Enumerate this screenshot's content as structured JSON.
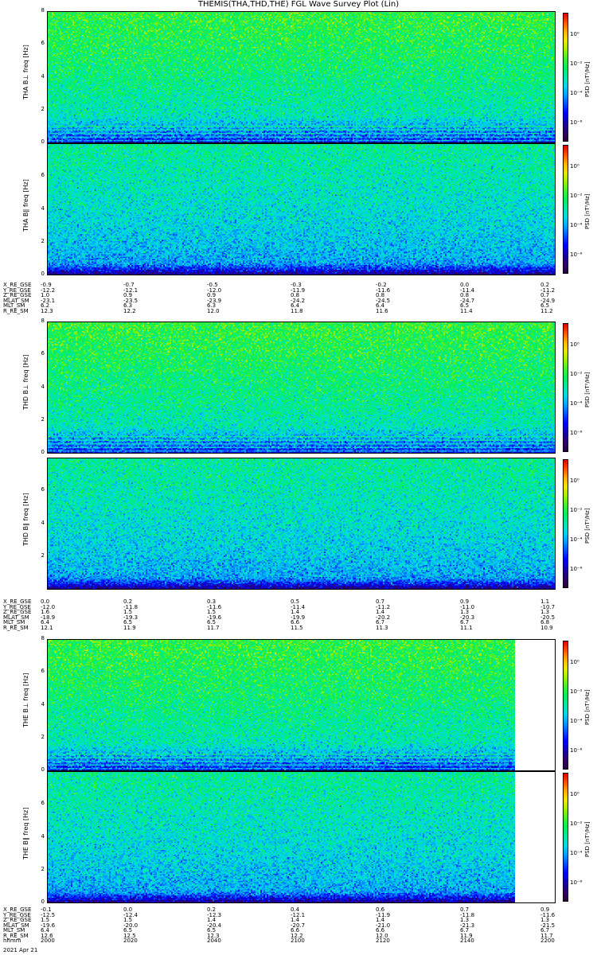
{
  "title": "THEMIS(THA,THD,THE) FGL Wave Survey Plot (Lin)",
  "colors": {
    "colormap": [
      "#2b0040",
      "#30006a",
      "#1400b0",
      "#0000ff",
      "#0050ff",
      "#00a0ff",
      "#00d8e8",
      "#00e8a8",
      "#00ee60",
      "#40f030",
      "#a0f000",
      "#f0e800",
      "#ffb000",
      "#ff5000",
      "#e00000"
    ],
    "background": "#ffffff"
  },
  "chart_data": [
    {
      "type": "heatmap",
      "id": "tha_bl",
      "ylabel": "THA B⊥ freq [Hz]",
      "yticks": [
        "0",
        "2",
        "4",
        "6",
        "8"
      ],
      "ylim": [
        0,
        8
      ],
      "colorbar": {
        "label": "PSD [nT²/Hz]",
        "ticks": [
          "10⁰",
          "10⁻²",
          "10⁻⁴",
          "10⁻⁶"
        ]
      },
      "time_coverage": [
        0,
        1
      ],
      "low_freq_bands": true
    },
    {
      "type": "heatmap",
      "id": "tha_bpar",
      "ylabel": "THA B∥ freq [Hz]",
      "yticks": [
        "0",
        "2",
        "4",
        "6"
      ],
      "ylim": [
        0,
        8
      ],
      "colorbar": {
        "label": "PSD [nT²/Hz]",
        "ticks": [
          "10⁰",
          "10⁻²",
          "10⁻⁴",
          "10⁻⁶"
        ]
      },
      "time_coverage": [
        0,
        1
      ],
      "low_freq_bands": false
    },
    {
      "type": "heatmap",
      "id": "thd_bl",
      "ylabel": "THD B⊥ freq [Hz]",
      "yticks": [
        "0",
        "2",
        "4",
        "6",
        "8"
      ],
      "ylim": [
        0,
        8
      ],
      "colorbar": {
        "label": "PSD [nT²/Hz]",
        "ticks": [
          "10⁰",
          "10⁻²",
          "10⁻⁴",
          "10⁻⁶"
        ]
      },
      "time_coverage": [
        0,
        1
      ],
      "low_freq_bands": true
    },
    {
      "type": "heatmap",
      "id": "thd_bpar",
      "ylabel": "THD B∥ freq [Hz]",
      "yticks": [
        "2",
        "4",
        "6"
      ],
      "ylim": [
        0,
        8
      ],
      "colorbar": {
        "label": "PSD [nT²/Hz]",
        "ticks": [
          "10⁰",
          "10⁻²",
          "10⁻⁴",
          "10⁻⁶"
        ]
      },
      "time_coverage": [
        0,
        1
      ],
      "low_freq_bands": false
    },
    {
      "type": "heatmap",
      "id": "the_bl",
      "ylabel": "THE B⊥ freq [Hz]",
      "yticks": [
        "0",
        "2",
        "4",
        "6",
        "8"
      ],
      "ylim": [
        0,
        8
      ],
      "colorbar": {
        "label": "PSD [nT²/Hz]",
        "ticks": [
          "10⁰",
          "10⁻²",
          "10⁻⁴",
          "10⁻⁶"
        ]
      },
      "time_coverage": [
        0,
        0.92
      ],
      "low_freq_bands": true
    },
    {
      "type": "heatmap",
      "id": "the_bpar",
      "ylabel": "THE B∥ freq [Hz]",
      "yticks": [
        "0",
        "2",
        "4",
        "6"
      ],
      "ylim": [
        0,
        8
      ],
      "colorbar": {
        "label": "PSD [nT²/Hz]",
        "ticks": [
          "10⁰",
          "10⁻²",
          "10⁻⁴",
          "10⁻⁶"
        ]
      },
      "time_coverage": [
        0,
        0.92
      ],
      "low_freq_bands": false
    }
  ],
  "ephemeris_blocks": [
    {
      "id": "tha",
      "rows": [
        {
          "name": "X_RE_GSE",
          "values": [
            "-0.9",
            "-0.7",
            "-0.5",
            "-0.3",
            "-0.2",
            "0.0",
            "0.2"
          ]
        },
        {
          "name": "Y_RE_GSE",
          "values": [
            "-12.2",
            "-12.1",
            "-12.0",
            "-11.9",
            "-11.6",
            "-11.4",
            "-11.2"
          ]
        },
        {
          "name": "Z_RE_GSE",
          "values": [
            "1.0",
            "0.9",
            "0.9",
            "0.8",
            "0.8",
            "0.8",
            "0.7"
          ]
        },
        {
          "name": "MLAT_SM",
          "values": [
            "-23.1",
            "-23.5",
            "-23.9",
            "-24.2",
            "-24.5",
            "-24.7",
            "-24.9"
          ]
        },
        {
          "name": "MLT_SM",
          "values": [
            "6.2",
            "6.3",
            "6.3",
            "6.4",
            "6.4",
            "6.5",
            "6.5"
          ]
        },
        {
          "name": "R_RE_SM",
          "values": [
            "12.3",
            "12.2",
            "12.0",
            "11.8",
            "11.6",
            "11.4",
            "11.2"
          ]
        }
      ]
    },
    {
      "id": "thd",
      "rows": [
        {
          "name": "X_RE_GSE",
          "values": [
            "0.0",
            "0.2",
            "0.3",
            "0.5",
            "0.7",
            "0.9",
            "1.1"
          ]
        },
        {
          "name": "Y_RE_GSE",
          "values": [
            "-12.0",
            "-11.8",
            "-11.6",
            "-11.4",
            "-11.2",
            "-11.0",
            "-10.7"
          ]
        },
        {
          "name": "Z_RE_GSE",
          "values": [
            "1.6",
            "1.5",
            "1.5",
            "1.4",
            "1.4",
            "1.3",
            "1.3"
          ]
        },
        {
          "name": "MLAT_SM",
          "values": [
            "-18.9",
            "-19.3",
            "-19.6",
            "-19.9",
            "-20.2",
            "-20.3",
            "-20.5"
          ]
        },
        {
          "name": "MLT_SM",
          "values": [
            "6.4",
            "6.5",
            "6.5",
            "6.6",
            "6.7",
            "6.7",
            "6.8"
          ]
        },
        {
          "name": "R_RE_SM",
          "values": [
            "12.1",
            "11.9",
            "11.7",
            "11.5",
            "11.3",
            "11.1",
            "10.9"
          ]
        }
      ]
    },
    {
      "id": "the",
      "rows": [
        {
          "name": "X_RE_GSE",
          "values": [
            "-0.1",
            "0.0",
            "0.2",
            "0.4",
            "0.6",
            "0.7",
            "0.9"
          ]
        },
        {
          "name": "Y_RE_GSE",
          "values": [
            "-12.5",
            "-12.4",
            "-12.3",
            "-12.1",
            "-11.9",
            "-11.8",
            "-11.6"
          ]
        },
        {
          "name": "Z_RE_GSE",
          "values": [
            "1.5",
            "1.5",
            "1.4",
            "1.4",
            "1.4",
            "1.3",
            "1.3"
          ]
        },
        {
          "name": "MLAT_SM",
          "values": [
            "-19.6",
            "-20.0",
            "-20.4",
            "-20.7",
            "-21.0",
            "-21.3",
            "-21.5"
          ]
        },
        {
          "name": "MLT_SM",
          "values": [
            "6.4",
            "6.5",
            "6.5",
            "6.6",
            "6.6",
            "6.7",
            "6.7"
          ]
        },
        {
          "name": "R_RE_SM",
          "values": [
            "12.6",
            "12.5",
            "12.3",
            "12.2",
            "12.0",
            "11.9",
            "11.7"
          ]
        },
        {
          "name": "hhmm",
          "values": [
            "2000",
            "2020",
            "2040",
            "2100",
            "2120",
            "2140",
            "2200"
          ]
        }
      ]
    }
  ],
  "footer": {
    "date": "2021 Apr 21"
  }
}
